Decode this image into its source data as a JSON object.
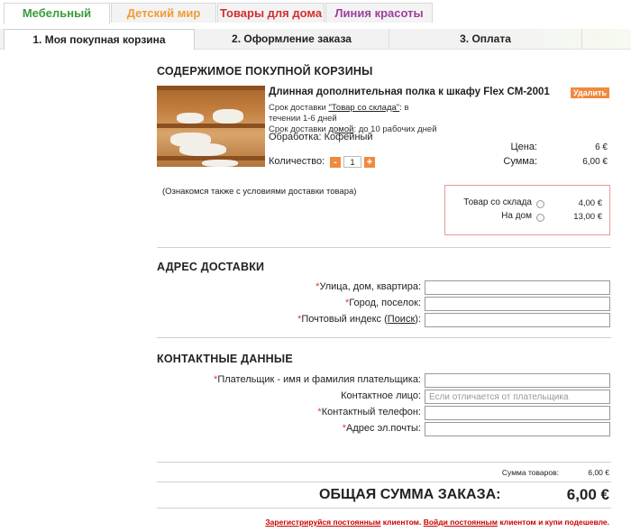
{
  "category_tabs": [
    {
      "label": "Мебельный",
      "color": "#3b9b3b"
    },
    {
      "label": "Детский мир",
      "color": "#f19b37"
    },
    {
      "label": "Товары для дома",
      "color": "#d03030"
    },
    {
      "label": "Линия красоты",
      "color": "#9b3f9b"
    }
  ],
  "steps": [
    {
      "label": "1. Моя покупная корзина"
    },
    {
      "label": "2. Оформление заказа"
    },
    {
      "label": "3. Оплата"
    }
  ],
  "cart": {
    "title": "СОДЕРЖИМОЕ ПОКУПНОЙ КОРЗИНЫ",
    "product": {
      "name": "Длинная дополнительная полка к шкафу Flex CM-2001",
      "delete_label": "Удалить",
      "delivery_stock_prefix": "Срок доставки",
      "delivery_stock_link": "\"Товар со склада\"",
      "delivery_stock_suffix": ": в",
      "delivery_stock_days": "течении 1-6 дней",
      "delivery_home_prefix": "Срок доставки",
      "delivery_home_link": "домой",
      "delivery_home_suffix": ": до 10 рабочих дней",
      "finish_label": "Обработка:",
      "finish_value": "Кофейный",
      "price_label": "Цена:",
      "price_value": "6 €",
      "sum_label": "Сумма:",
      "sum_value": "6,00 €",
      "quantity_label": "Количество:",
      "quantity_minus": "-",
      "quantity_value": "1",
      "quantity_plus": "+"
    },
    "note": "(Ознакомся также с условиями доставки товара)",
    "delivery_options": [
      {
        "label": "Товар со склада",
        "price": "4,00 €"
      },
      {
        "label": "На дом",
        "price": "13,00 €"
      }
    ]
  },
  "address": {
    "title": "АДРЕС ДОСТАВКИ",
    "fields": [
      {
        "required": "*",
        "label": "Улица, дом, квартира:"
      },
      {
        "required": "*",
        "label": "Город, поселок:"
      },
      {
        "required": "*",
        "label": "Почтовый индекс (",
        "link": "Поиск",
        "suffix": "):"
      }
    ]
  },
  "contacts": {
    "title": "КОНТАКТНЫЕ ДАННЫЕ",
    "payer": {
      "required": "*",
      "label": "Плательщик - имя и фамилия плательщика:"
    },
    "contact_person": {
      "label": "Контактное лицо:",
      "placeholder": "Если отличается от плательщика"
    },
    "phone": {
      "required": "*",
      "label": "Контактный телефон:"
    },
    "email": {
      "required": "*",
      "label": "Адрес эл.почты:"
    }
  },
  "totals": {
    "goods_label": "Сумма товаров:",
    "goods_value": "6,00 €",
    "order_label": "ОБЩАЯ СУММА ЗАКАЗА:",
    "order_value": "6,00 €"
  },
  "footer": {
    "register_link": "Зарегистрируйся постоянным",
    "text1": " клиентом. ",
    "login_link": "Войди постоянным",
    "text2": " клиентом и купи подешевле."
  }
}
